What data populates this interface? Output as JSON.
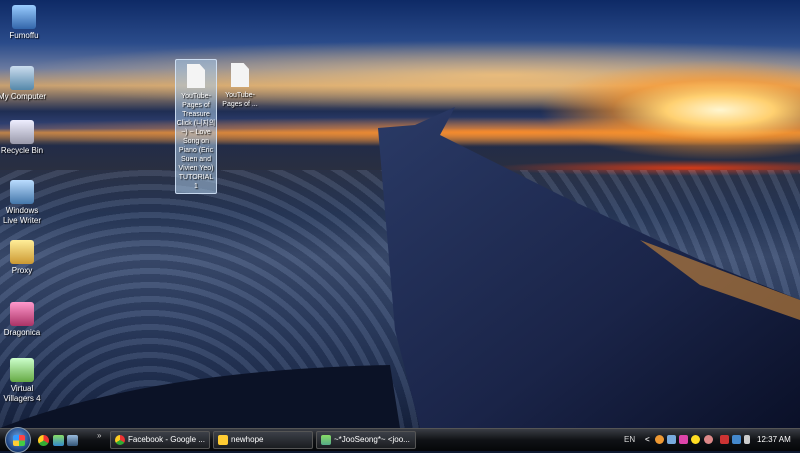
{
  "desktop_icons": [
    {
      "label": "Fumoffu",
      "icon": "users-icon"
    },
    {
      "label": "My Computer",
      "icon": "computer-icon"
    },
    {
      "label": "Recycle Bin",
      "icon": "recycle-bin-icon"
    },
    {
      "label": "Windows Live Writer",
      "icon": "live-writer-icon"
    },
    {
      "label": "Proxy",
      "icon": "folder-icon"
    },
    {
      "label": "Dragonica",
      "icon": "game-icon"
    },
    {
      "label": "Virtual Villagers 4",
      "icon": "game-icon"
    }
  ],
  "files": [
    {
      "label": "YouTube- Pages of Treasure Click (니지의~) ~ Love Song on Piano (Eric Suen and Vivien Yeo) TUTORIAL 1",
      "selected": true
    },
    {
      "label": "YouTube- Pages of ...",
      "selected": false
    }
  ],
  "taskbar": {
    "overflow": "»",
    "tasks": [
      {
        "label": "Facebook - Google ...",
        "icon": "chrome-icon"
      },
      {
        "label": "newhope",
        "icon": "folder-icon"
      },
      {
        "label": "~*JooSeong*~ <joo...",
        "icon": "messenger-icon"
      }
    ],
    "language": "EN",
    "tray_expand": "<",
    "clock": "12:37 AM"
  }
}
